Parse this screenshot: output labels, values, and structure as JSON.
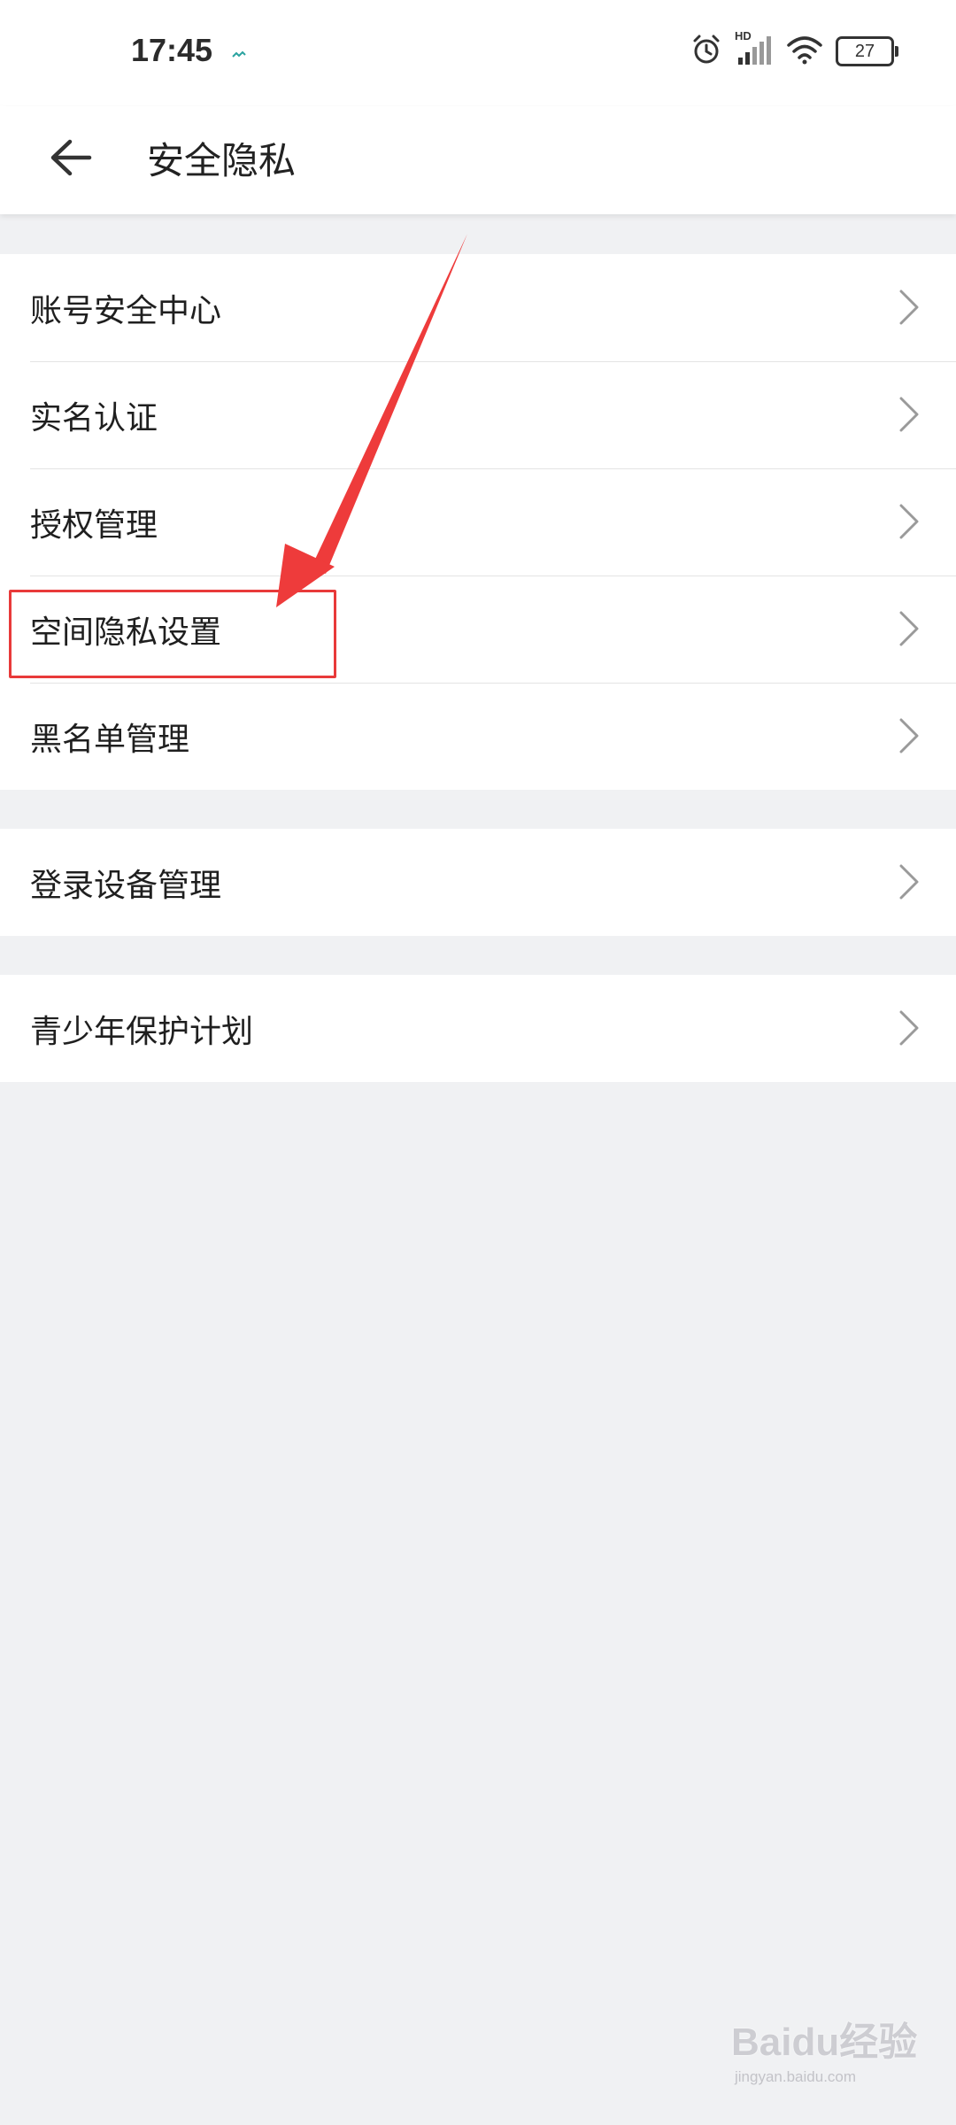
{
  "status_bar": {
    "time": "17:45",
    "battery_level": "27",
    "icons": [
      "app-notification-icon",
      "alarm-icon",
      "hd-signal-icon",
      "wifi-icon",
      "battery-icon"
    ],
    "signal_badge": "HD"
  },
  "header": {
    "title": "安全隐私",
    "back_icon": "arrow-left-icon"
  },
  "groups": [
    {
      "items": [
        {
          "label": "账号安全中心"
        },
        {
          "label": "实名认证"
        },
        {
          "label": "授权管理"
        },
        {
          "label": "空间隐私设置",
          "highlighted": true
        },
        {
          "label": "黑名单管理"
        }
      ]
    },
    {
      "items": [
        {
          "label": "登录设备管理"
        }
      ]
    },
    {
      "items": [
        {
          "label": "青少年保护计划"
        }
      ]
    }
  ],
  "annotation": {
    "color": "#e83a3a",
    "target": "空间隐私设置"
  },
  "watermark": {
    "brand": "Baidu经验",
    "url": "jingyan.baidu.com"
  },
  "colors": {
    "background": "#f0f1f3",
    "surface": "#ffffff",
    "text": "#1f1f1f",
    "chevron": "#9a9a9a"
  }
}
